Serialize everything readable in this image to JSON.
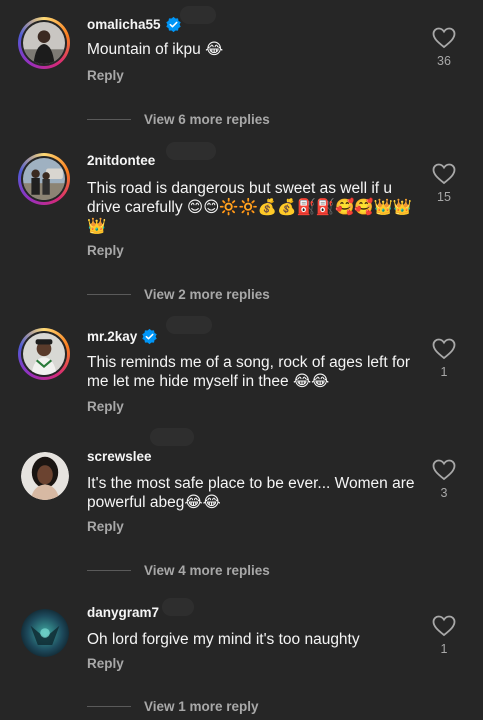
{
  "comments": [
    {
      "username": "omalicha55",
      "verified": true,
      "text": "Mountain of ikpu 😂",
      "reply_label": "Reply",
      "likes": "36",
      "more_replies": "View 6 more replies"
    },
    {
      "username": "2nitdontee",
      "verified": false,
      "text": "This road is dangerous but sweet as well if u drive carefully 😊😊🔆🔆💰💰⛽⛽🥰🥰👑👑👑",
      "reply_label": "Reply",
      "likes": "15",
      "more_replies": "View 2 more replies"
    },
    {
      "username": "mr.2kay",
      "verified": true,
      "text": "This reminds me of a song, rock of ages left for me let me hide myself in thee 😂😂",
      "reply_label": "Reply",
      "likes": "1"
    },
    {
      "username": "screwslee",
      "verified": false,
      "text": "It's the most safe place to be ever... Women are powerful abeg😂😂",
      "reply_label": "Reply",
      "likes": "3",
      "more_replies": "View 4 more replies"
    },
    {
      "username": "danygram7",
      "verified": false,
      "text": "Oh lord forgive my mind it's too naughty",
      "reply_label": "Reply",
      "likes": "1",
      "more_replies": "View 1 more reply"
    }
  ],
  "colors": {
    "background": "#262626",
    "text": "#f5f5f5",
    "secondary_text": "#a8a8a8",
    "verified_badge": "#0095f6"
  },
  "icons": [
    "verified-badge-icon",
    "heart-outline-icon"
  ]
}
